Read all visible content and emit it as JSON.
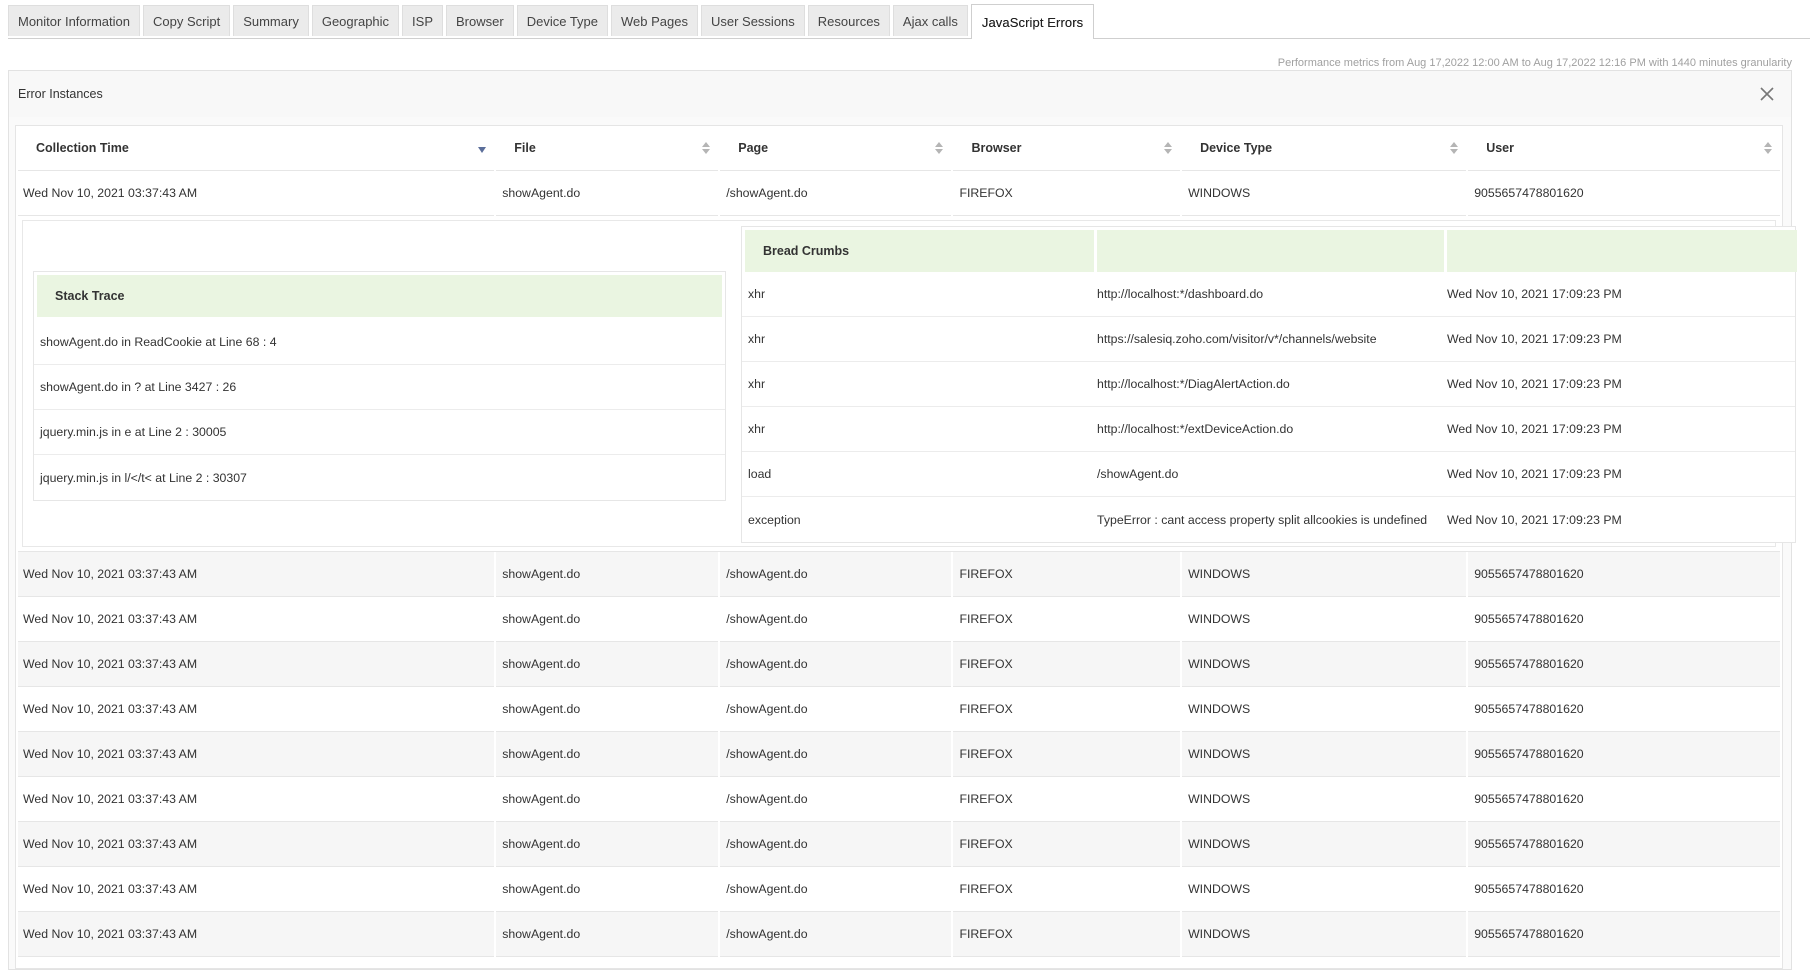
{
  "tabs": [
    {
      "label": "Monitor Information",
      "active": false
    },
    {
      "label": "Copy Script",
      "active": false
    },
    {
      "label": "Summary",
      "active": false
    },
    {
      "label": "Geographic",
      "active": false
    },
    {
      "label": "ISP",
      "active": false
    },
    {
      "label": "Browser",
      "active": false
    },
    {
      "label": "Device Type",
      "active": false
    },
    {
      "label": "Web Pages",
      "active": false
    },
    {
      "label": "User Sessions",
      "active": false
    },
    {
      "label": "Resources",
      "active": false
    },
    {
      "label": "Ajax calls",
      "active": false
    },
    {
      "label": "JavaScript Errors",
      "active": true
    }
  ],
  "perf_note": "Performance metrics from Aug 17,2022 12:00 AM to Aug 17,2022 12:16 PM with 1440 minutes granularity",
  "panel": {
    "title": "Error Instances",
    "close_icon": "close-icon"
  },
  "table": {
    "columns": [
      "Collection Time",
      "File",
      "Page",
      "Browser",
      "Device Type",
      "User"
    ],
    "sorted_column": "Collection Time",
    "expanded_row": {
      "cells": [
        "Wed Nov 10, 2021 03:37:43 AM",
        "showAgent.do",
        "/showAgent.do",
        "FIREFOX",
        "WINDOWS",
        "9055657478801620"
      ],
      "stack_trace": {
        "title": "Stack Trace",
        "lines": [
          "showAgent.do in ReadCookie at Line 68 : 4",
          "showAgent.do in ? at Line 3427 : 26",
          "jquery.min.js in e at Line 2 : 30005",
          "jquery.min.js in l/</t< at Line 2 : 30307"
        ]
      },
      "bread_crumbs": {
        "title": "Bread Crumbs",
        "rows": [
          {
            "type": "xhr",
            "detail": "http://localhost:*/dashboard.do",
            "time": "Wed Nov 10, 2021 17:09:23 PM"
          },
          {
            "type": "xhr",
            "detail": "https://salesiq.zoho.com/visitor/v*/channels/website",
            "time": "Wed Nov 10, 2021 17:09:23 PM"
          },
          {
            "type": "xhr",
            "detail": "http://localhost:*/DiagAlertAction.do",
            "time": "Wed Nov 10, 2021 17:09:23 PM"
          },
          {
            "type": "xhr",
            "detail": "http://localhost:*/extDeviceAction.do",
            "time": "Wed Nov 10, 2021 17:09:23 PM"
          },
          {
            "type": "load",
            "detail": "/showAgent.do",
            "time": "Wed Nov 10, 2021 17:09:23 PM"
          },
          {
            "type": "exception",
            "detail": "TypeError : cant access property split allcookies is undefined",
            "time": "Wed Nov 10, 2021 17:09:23 PM"
          }
        ]
      }
    },
    "rows": [
      [
        "Wed Nov 10, 2021 03:37:43 AM",
        "showAgent.do",
        "/showAgent.do",
        "FIREFOX",
        "WINDOWS",
        "9055657478801620"
      ],
      [
        "Wed Nov 10, 2021 03:37:43 AM",
        "showAgent.do",
        "/showAgent.do",
        "FIREFOX",
        "WINDOWS",
        "9055657478801620"
      ],
      [
        "Wed Nov 10, 2021 03:37:43 AM",
        "showAgent.do",
        "/showAgent.do",
        "FIREFOX",
        "WINDOWS",
        "9055657478801620"
      ],
      [
        "Wed Nov 10, 2021 03:37:43 AM",
        "showAgent.do",
        "/showAgent.do",
        "FIREFOX",
        "WINDOWS",
        "9055657478801620"
      ],
      [
        "Wed Nov 10, 2021 03:37:43 AM",
        "showAgent.do",
        "/showAgent.do",
        "FIREFOX",
        "WINDOWS",
        "9055657478801620"
      ],
      [
        "Wed Nov 10, 2021 03:37:43 AM",
        "showAgent.do",
        "/showAgent.do",
        "FIREFOX",
        "WINDOWS",
        "9055657478801620"
      ],
      [
        "Wed Nov 10, 2021 03:37:43 AM",
        "showAgent.do",
        "/showAgent.do",
        "FIREFOX",
        "WINDOWS",
        "9055657478801620"
      ],
      [
        "Wed Nov 10, 2021 03:37:43 AM",
        "showAgent.do",
        "/showAgent.do",
        "FIREFOX",
        "WINDOWS",
        "9055657478801620"
      ],
      [
        "Wed Nov 10, 2021 03:37:43 AM",
        "showAgent.do",
        "/showAgent.do",
        "FIREFOX",
        "WINDOWS",
        "9055657478801620"
      ]
    ]
  },
  "colors": {
    "section_header_bg": "#eaf5e1",
    "sort_active": "#5b6e9a",
    "sort_inactive": "#b5b5b5"
  }
}
